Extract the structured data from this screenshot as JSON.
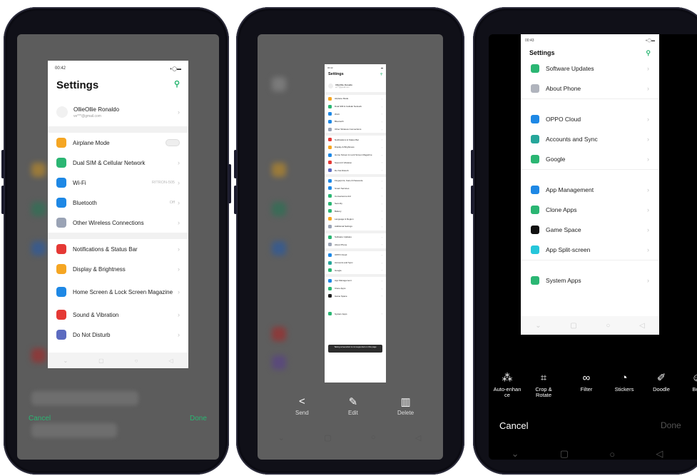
{
  "phone1": {
    "card": {
      "status_time": "00:42",
      "title": "Settings",
      "account": {
        "name": "OllieOllie Ronaldo",
        "email": "ve***@gmail.com"
      },
      "group1": [
        {
          "label": "Airplane Mode",
          "icon": "airplane-icon",
          "color": "#f5a623",
          "value": ""
        },
        {
          "label": "Dual SIM & Cellular Network",
          "icon": "sim-icon",
          "color": "#2bb673",
          "value": ""
        },
        {
          "label": "Wi-Fi",
          "icon": "wifi-icon",
          "color": "#1e88e5",
          "value": "RITRON-505"
        },
        {
          "label": "Bluetooth",
          "icon": "bluetooth-icon",
          "color": "#1e88e5",
          "value": "Off"
        },
        {
          "label": "Other Wireless Connections",
          "icon": "wireless-icon",
          "color": "#9aa3b5",
          "value": ""
        }
      ],
      "group2": [
        {
          "label": "Notifications & Status Bar",
          "icon": "notification-icon",
          "color": "#e53935"
        },
        {
          "label": "Display & Brightness",
          "icon": "brightness-icon",
          "color": "#f5a623"
        },
        {
          "label": "Home Screen & Lock Screen Magazine",
          "icon": "home-screen-icon",
          "color": "#1e88e5"
        },
        {
          "label": "Sound & Vibration",
          "icon": "sound-icon",
          "color": "#e53935"
        },
        {
          "label": "Do Not Disturb",
          "icon": "moon-icon",
          "color": "#5c6bc0"
        }
      ]
    },
    "cancel": "Cancel",
    "done": "Done"
  },
  "phone2": {
    "card": {
      "title": "Settings",
      "account": {
        "name": "OllieOllie Ronaldo",
        "email": "ve***@gmail.com"
      },
      "group1": [
        {
          "label": "Airplane Mode",
          "color": "#f5a623"
        },
        {
          "label": "Dual SIM & Cellular Network",
          "color": "#2bb673"
        },
        {
          "label": "Wi-Fi",
          "color": "#1e88e5"
        },
        {
          "label": "Bluetooth",
          "color": "#1e88e5"
        },
        {
          "label": "Other Wireless Connections",
          "color": "#9aa3b5"
        }
      ],
      "group2": [
        {
          "label": "Notifications & Status Bar",
          "color": "#e53935"
        },
        {
          "label": "Display & Brightness",
          "color": "#f5a623"
        },
        {
          "label": "Home Screen & Lock Screen Magazine",
          "color": "#1e88e5"
        },
        {
          "label": "Sound & Vibration",
          "color": "#e53935"
        },
        {
          "label": "Do Not Disturb",
          "color": "#5c6bc0"
        }
      ],
      "group3": [
        {
          "label": "Fingerprint, Face & Passcode",
          "color": "#1e88e5"
        },
        {
          "label": "Smart Services",
          "color": "#1e88e5"
        },
        {
          "label": "Convenience Aid",
          "color": "#2bb673"
        },
        {
          "label": "Security",
          "color": "#2bb673"
        },
        {
          "label": "Battery",
          "color": "#2bb673"
        },
        {
          "label": "Language & Region",
          "color": "#f5a623"
        },
        {
          "label": "Additional Settings",
          "color": "#9aa3b5"
        }
      ],
      "group4": [
        {
          "label": "Software Updates",
          "color": "#2bb673"
        },
        {
          "label": "About Phone",
          "color": "#9aa3b5"
        }
      ],
      "group5": [
        {
          "label": "OPPO Cloud",
          "color": "#1e88e5"
        },
        {
          "label": "Accounts and Sync",
          "color": "#26a69a"
        },
        {
          "label": "Google",
          "color": "#2bb673"
        }
      ],
      "group6": [
        {
          "label": "App Management",
          "color": "#1e88e5"
        },
        {
          "label": "Clone Apps",
          "color": "#2bb673"
        },
        {
          "label": "Game Space",
          "color": "#212121"
        }
      ],
      "toast": "Taking screenshot is not supported on this page",
      "group7": [
        {
          "label": "System Apps",
          "color": "#2bb673"
        }
      ]
    },
    "actions": [
      {
        "label": "Send",
        "icon": "share-icon",
        "glyph": "≺"
      },
      {
        "label": "Edit",
        "icon": "edit-icon",
        "glyph": "✎"
      },
      {
        "label": "Delete",
        "icon": "trash-icon",
        "glyph": "🗑"
      }
    ]
  },
  "phone3": {
    "card": {
      "status_time": "00:43",
      "title": "Settings",
      "group1": [
        {
          "label": "Software Updates",
          "color": "#2bb673"
        },
        {
          "label": "About Phone",
          "color": "#b0b4bd"
        }
      ],
      "group2": [
        {
          "label": "OPPO Cloud",
          "color": "#1e88e5"
        },
        {
          "label": "Accounts and Sync",
          "color": "#26a69a"
        },
        {
          "label": "Google",
          "color": "#2bb673"
        }
      ],
      "group3": [
        {
          "label": "App Management",
          "color": "#1e88e5"
        },
        {
          "label": "Clone Apps",
          "color": "#2bb673"
        },
        {
          "label": "Game Space",
          "color": "#111111"
        },
        {
          "label": "App Split-screen",
          "color": "#26c6da"
        }
      ],
      "group4": [
        {
          "label": "System Apps",
          "color": "#2bb673"
        }
      ]
    },
    "tools": [
      {
        "label": "Auto-enhan ce",
        "icon": "magic-wand-icon",
        "glyph": "⁂"
      },
      {
        "label": "Crop & Rotate",
        "icon": "crop-icon",
        "glyph": "⌗"
      },
      {
        "label": "Filter",
        "icon": "filter-icon",
        "glyph": "∞"
      },
      {
        "label": "Stickers",
        "icon": "sticker-icon",
        "glyph": "◔"
      },
      {
        "label": "Doodle",
        "icon": "doodle-icon",
        "glyph": "✐"
      },
      {
        "label": "Bea",
        "icon": "beauty-icon",
        "glyph": "☺"
      }
    ],
    "cancel": "Cancel",
    "done": "Done"
  }
}
